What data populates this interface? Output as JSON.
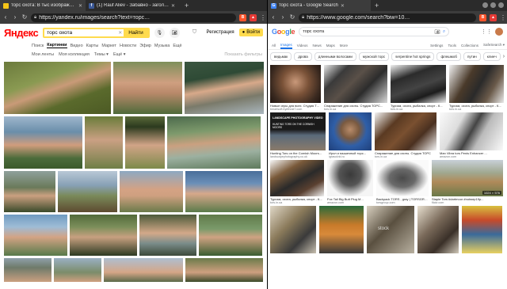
{
  "left": {
    "tabs": [
      {
        "title": "торс охота: В тыс изображен…",
        "active": true,
        "favicon_color": "#f5c518"
      },
      {
        "title": "(1) Rauf Aliev - Забавно - загол…",
        "active": false,
        "favicon_color": "#3b5998",
        "favicon_letter": "f"
      }
    ],
    "url": "https://yandex.ru/images/search?text=торс…",
    "logo": "Яндекс",
    "search": {
      "query": "торс охота",
      "button": "Найти"
    },
    "register": "Регистрация",
    "login": "Войти",
    "nav": [
      "Поиск",
      "Картинки",
      "Видео",
      "Карты",
      "Маркет",
      "Новости",
      "Эфир",
      "Музыка",
      "Ещё"
    ],
    "nav_current": "Картинки",
    "subnav": [
      "Мои ленты",
      "Моя коллекция",
      "Темы ▾",
      "Ещё ▾"
    ],
    "reset_filters": "Показать фильтры"
  },
  "right": {
    "tabs": [
      {
        "title": "торс охота - Google Search",
        "active": true,
        "favicon_color": "#4285f4",
        "favicon_letter": "G"
      }
    ],
    "url": "https://www.google.com/search?biw=10…",
    "search": {
      "query": "торс охота"
    },
    "tabs_bar": [
      "All",
      "Images",
      "Videos",
      "News",
      "Maps",
      "More"
    ],
    "tabs_current": "Images",
    "tools_bar": [
      "Settings",
      "Tools",
      "Collections",
      "SafeSearch ▾"
    ],
    "chips": [
      "ведьмак",
      "дрова",
      "длинными волосами",
      "мужской торс",
      "serpentine hot springs",
      "флешмоб",
      "путин",
      "клинч"
    ],
    "results_row1": [
      {
        "caption": "Новые игры для всех. Студия ТОРС...",
        "source": "bmartsoft.byethost7.com"
      },
      {
        "caption": "Снаряжение для охоты. Студия ТОРС...",
        "source": "tors.in.ua"
      },
      {
        "caption": "Туризм, охота, рыбалка, спорт - К...",
        "source": "tors.in.ua"
      },
      {
        "caption": "Туризм, охота, рыбалка, спорт - К...",
        "source": "tors.in.ua"
      }
    ],
    "results_row2": [
      {
        "caption": "Hunting Tors on the Cornish Moors...",
        "source": "landscapephotography.co.uk",
        "banner": "LANDSCAPE PHOTOGRAPHY VIDEO",
        "banner2": "HUNTING TORS ON THE CORNISH MOORS"
      },
      {
        "caption": "Ирол и мышечный торс...",
        "source": "igrasolvid.ru"
      },
      {
        "caption": "Снаряжение для охоты. Студия ТОРС",
        "source": "tors.in.ua"
      },
      {
        "caption": "Man Vibra tors Penis Enhancer ...",
        "source": "amazon.com"
      }
    ],
    "results_row3": [
      {
        "caption": "Туризм, охота, рыбалка, спорт - К...",
        "source": "tors.in.ua"
      },
      {
        "caption": "Fox Tail Big Butt Plug M...",
        "source": "amazon.com"
      },
      {
        "caption": "Backpack TORS , gray | TORSGROUP",
        "source": "torsgroup.com"
      },
      {
        "caption": "Staple Tors #dartmoor #notwep19p...",
        "source": "flickr.com",
        "dims": "1024 × 576"
      }
    ],
    "row4_label": "stock"
  }
}
